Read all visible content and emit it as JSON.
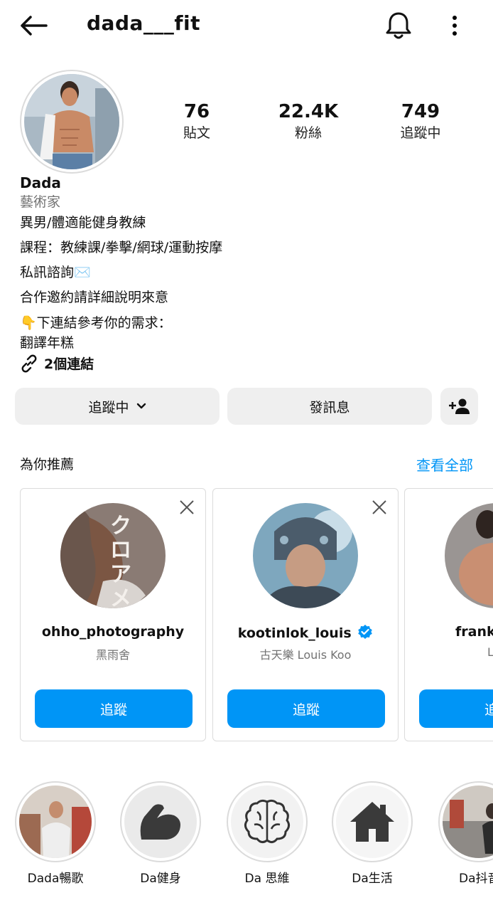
{
  "header": {
    "username": "dada___fit"
  },
  "profile": {
    "posts": {
      "value": "76",
      "label": "貼文"
    },
    "followers": {
      "value": "22.4K",
      "label": "粉絲"
    },
    "following": {
      "value": "749",
      "label": "追蹤中"
    },
    "name": "Dada",
    "category": "藝術家",
    "bio": [
      "異男/體適能健身教練",
      "課程：教練課/拳擊/網球/運動按摩",
      "私訊諮詢✉️",
      "合作邀約請詳細說明來意",
      "👇下連結參考你的需求：",
      "翻譯年糕"
    ],
    "links": "2個連結"
  },
  "actions": {
    "following_label": "追蹤中",
    "message_label": "發訊息"
  },
  "suggestions": {
    "title": "為你推薦",
    "see_all": "查看全部",
    "cards": [
      {
        "username": "ohho_photography",
        "subtitle": "黑雨舍",
        "follow": "追蹤",
        "verified": false
      },
      {
        "username": "kootinlok_louis",
        "subtitle": "古天樂 Louis Koo",
        "follow": "追蹤",
        "verified": true
      },
      {
        "username": "franks",
        "subtitle": "L",
        "follow": "追"
      }
    ]
  },
  "highlights": [
    {
      "label": "Dada暢歌",
      "icon": "photo"
    },
    {
      "label": "Da健身",
      "icon": "flexed-biceps-icon"
    },
    {
      "label": "Da 思維",
      "icon": "brain-icon"
    },
    {
      "label": "Da生活",
      "icon": "house-icon"
    },
    {
      "label": "Da抖音",
      "icon": "photo"
    }
  ],
  "colors": {
    "accent": "#0095f6",
    "button_gray": "#efefef",
    "muted": "#737373"
  }
}
